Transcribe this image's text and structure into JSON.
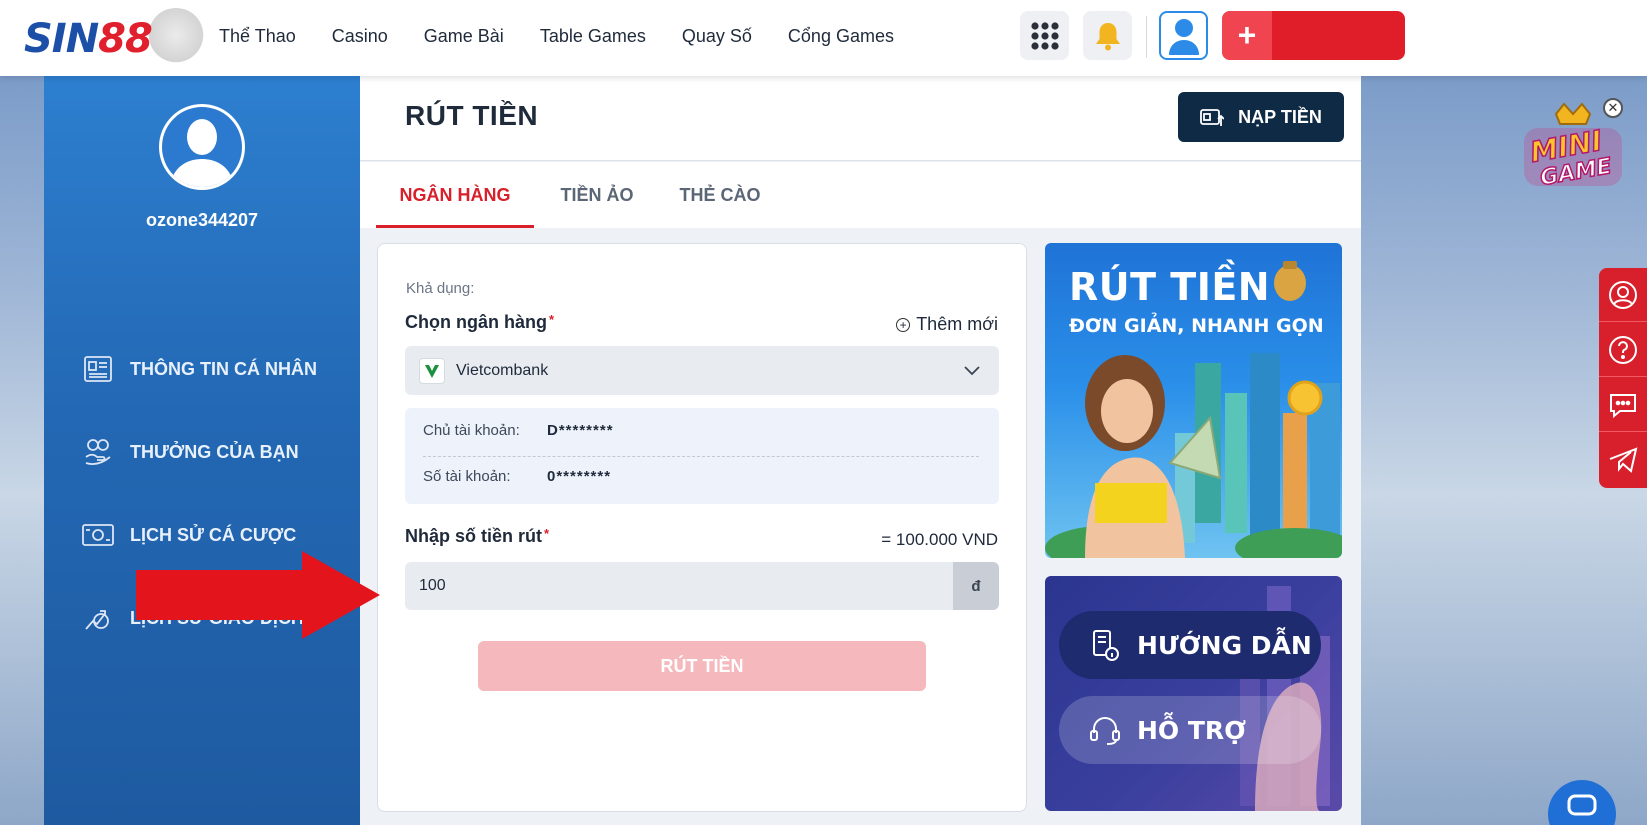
{
  "brand": {
    "logo_s": "SIN",
    "logo_n": "88"
  },
  "nav": {
    "items": [
      {
        "label": "Thể Thao"
      },
      {
        "label": "Casino"
      },
      {
        "label": "Game Bài"
      },
      {
        "label": "Table Games"
      },
      {
        "label": "Quay Số"
      },
      {
        "label": "Cổng Games"
      }
    ]
  },
  "header_actions": {
    "apps_icon": "grid-icon",
    "bell_icon": "bell-icon",
    "user_icon": "user-icon",
    "deposit_symbol": "+"
  },
  "sidebar": {
    "username": "ozone344207",
    "items": [
      {
        "label": "THÔNG TIN CÁ NHÂN",
        "icon": "profile-card-icon"
      },
      {
        "label": "THƯỞNG CỦA BẠN",
        "icon": "reward-icon"
      },
      {
        "label": "LỊCH SỬ CÁ CƯỢC",
        "icon": "bet-history-icon"
      },
      {
        "label": "LỊCH SỬ GIAO DỊCH",
        "icon": "transaction-history-icon"
      }
    ]
  },
  "main": {
    "title": "RÚT TIỀN",
    "deposit_button": "NẠP TIỀN",
    "tabs": [
      {
        "label": "NGÂN HÀNG",
        "active": true
      },
      {
        "label": "TIỀN ẢO",
        "active": false
      },
      {
        "label": "THẺ CÀO",
        "active": false
      }
    ]
  },
  "form": {
    "available_label": "Khả dụng:",
    "bank_label": "Chọn ngân hàng",
    "required_mark": "*",
    "add_new": "Thêm mới",
    "selected_bank": "Vietcombank",
    "account_holder_label": "Chủ tài khoản:",
    "account_holder_value": "D********",
    "account_number_label": "Số tài khoản:",
    "account_number_value": "0********",
    "amount_label": "Nhập số tiền rút",
    "amount_converted": "= 100.000 VND",
    "amount_value": "100",
    "amount_unit": "đ",
    "submit_label": "RÚT TIỀN"
  },
  "promo": {
    "title": "RÚT TIỀN",
    "subtitle": "ĐƠN GIẢN, NHANH GỌN"
  },
  "help": {
    "guide": "HƯỚNG DẪN",
    "support": "HỖ TRỢ"
  },
  "floating": {
    "mini_game_line1": "MINI",
    "mini_game_line2": "GAME",
    "close": "✕"
  },
  "colors": {
    "accent_red": "#d81f2a",
    "navy": "#0f2a44",
    "sidebar_blue": "#2368b4"
  }
}
